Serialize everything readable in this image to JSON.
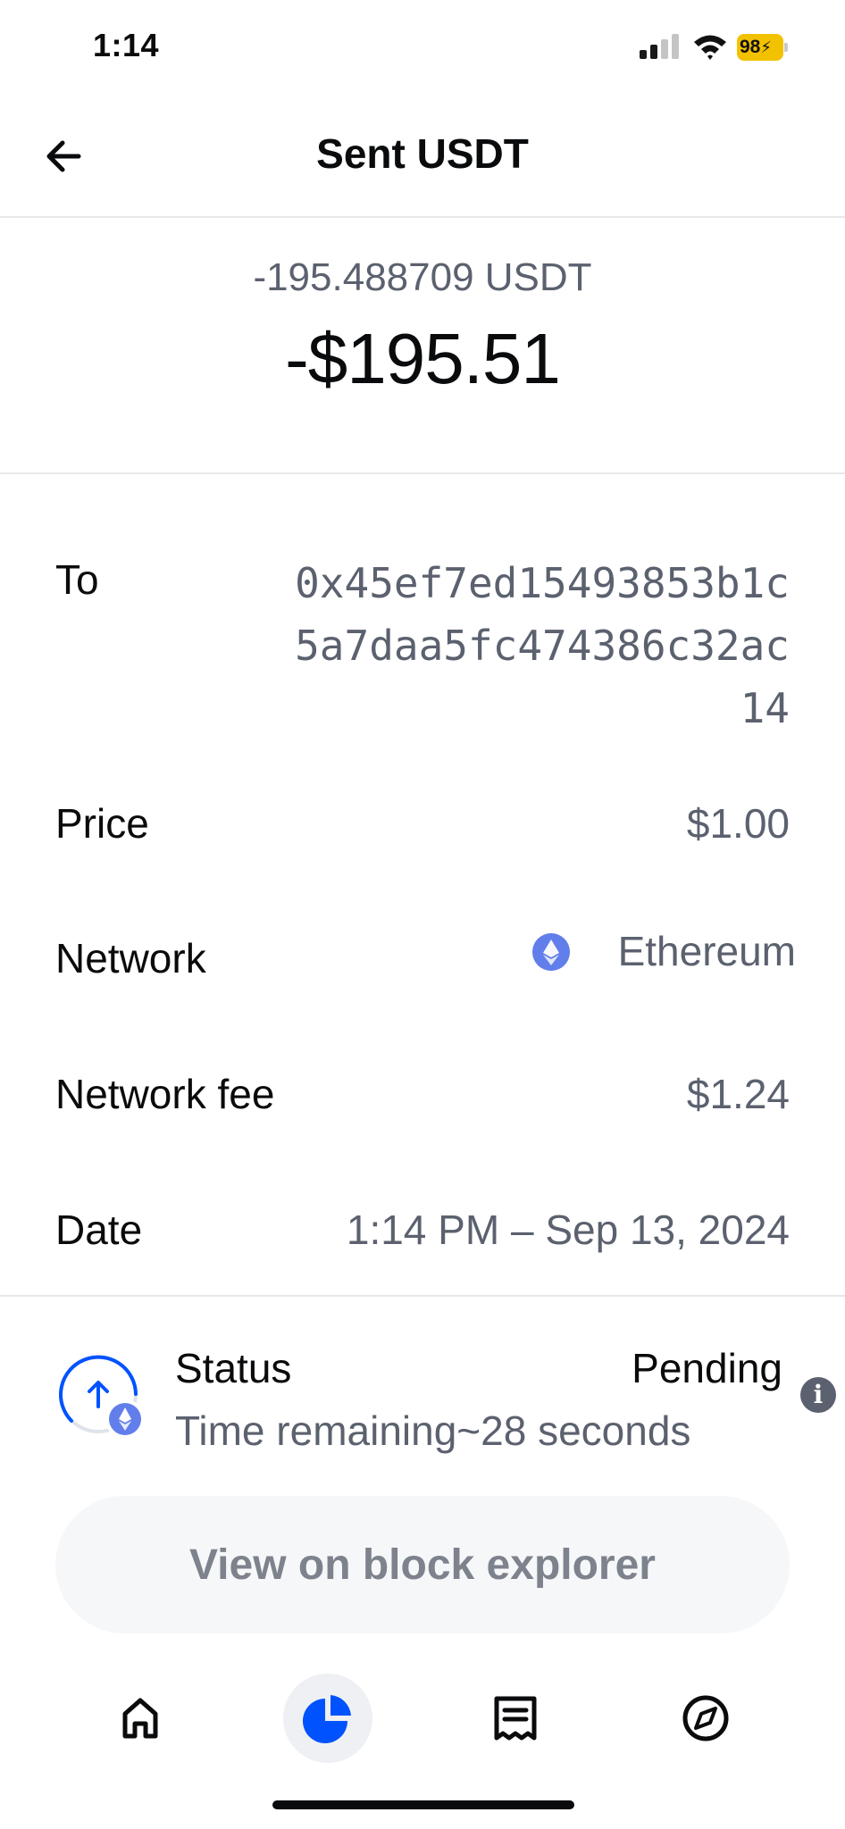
{
  "status_bar": {
    "time": "1:14",
    "battery": "98"
  },
  "header": {
    "title": "Sent USDT",
    "back_icon": "arrow-left-icon"
  },
  "amount": {
    "crypto": "-195.488709 USDT",
    "fiat": "-$195.51"
  },
  "details": {
    "to_label": "To",
    "to_value": "0x45ef7ed15493853b1c5a7daa5fc474386c32ac14",
    "price_label": "Price",
    "price_value": "$1.00",
    "network_label": "Network",
    "network_value": "Ethereum",
    "network_icon": "ethereum-icon",
    "fee_label": "Network fee",
    "fee_value": "$1.24",
    "date_label": "Date",
    "date_value": "1:14 PM – Sep 13, 2024"
  },
  "status": {
    "label": "Status",
    "value": "Pending",
    "time_remaining": "Time remaining~28 seconds",
    "icon": "send-pending-icon",
    "info_icon": "info-icon"
  },
  "explorer_button": {
    "label": "View on block explorer"
  },
  "tab_bar": {
    "tabs": [
      {
        "icon": "home-icon",
        "active": false
      },
      {
        "icon": "pie-chart-icon",
        "active": true
      },
      {
        "icon": "receipt-icon",
        "active": false
      },
      {
        "icon": "compass-icon",
        "active": false
      }
    ]
  },
  "colors": {
    "accent": "#0052ff",
    "ethereum": "#627eea",
    "muted_text": "#5b616e",
    "button_bg": "#f5f7f9"
  }
}
